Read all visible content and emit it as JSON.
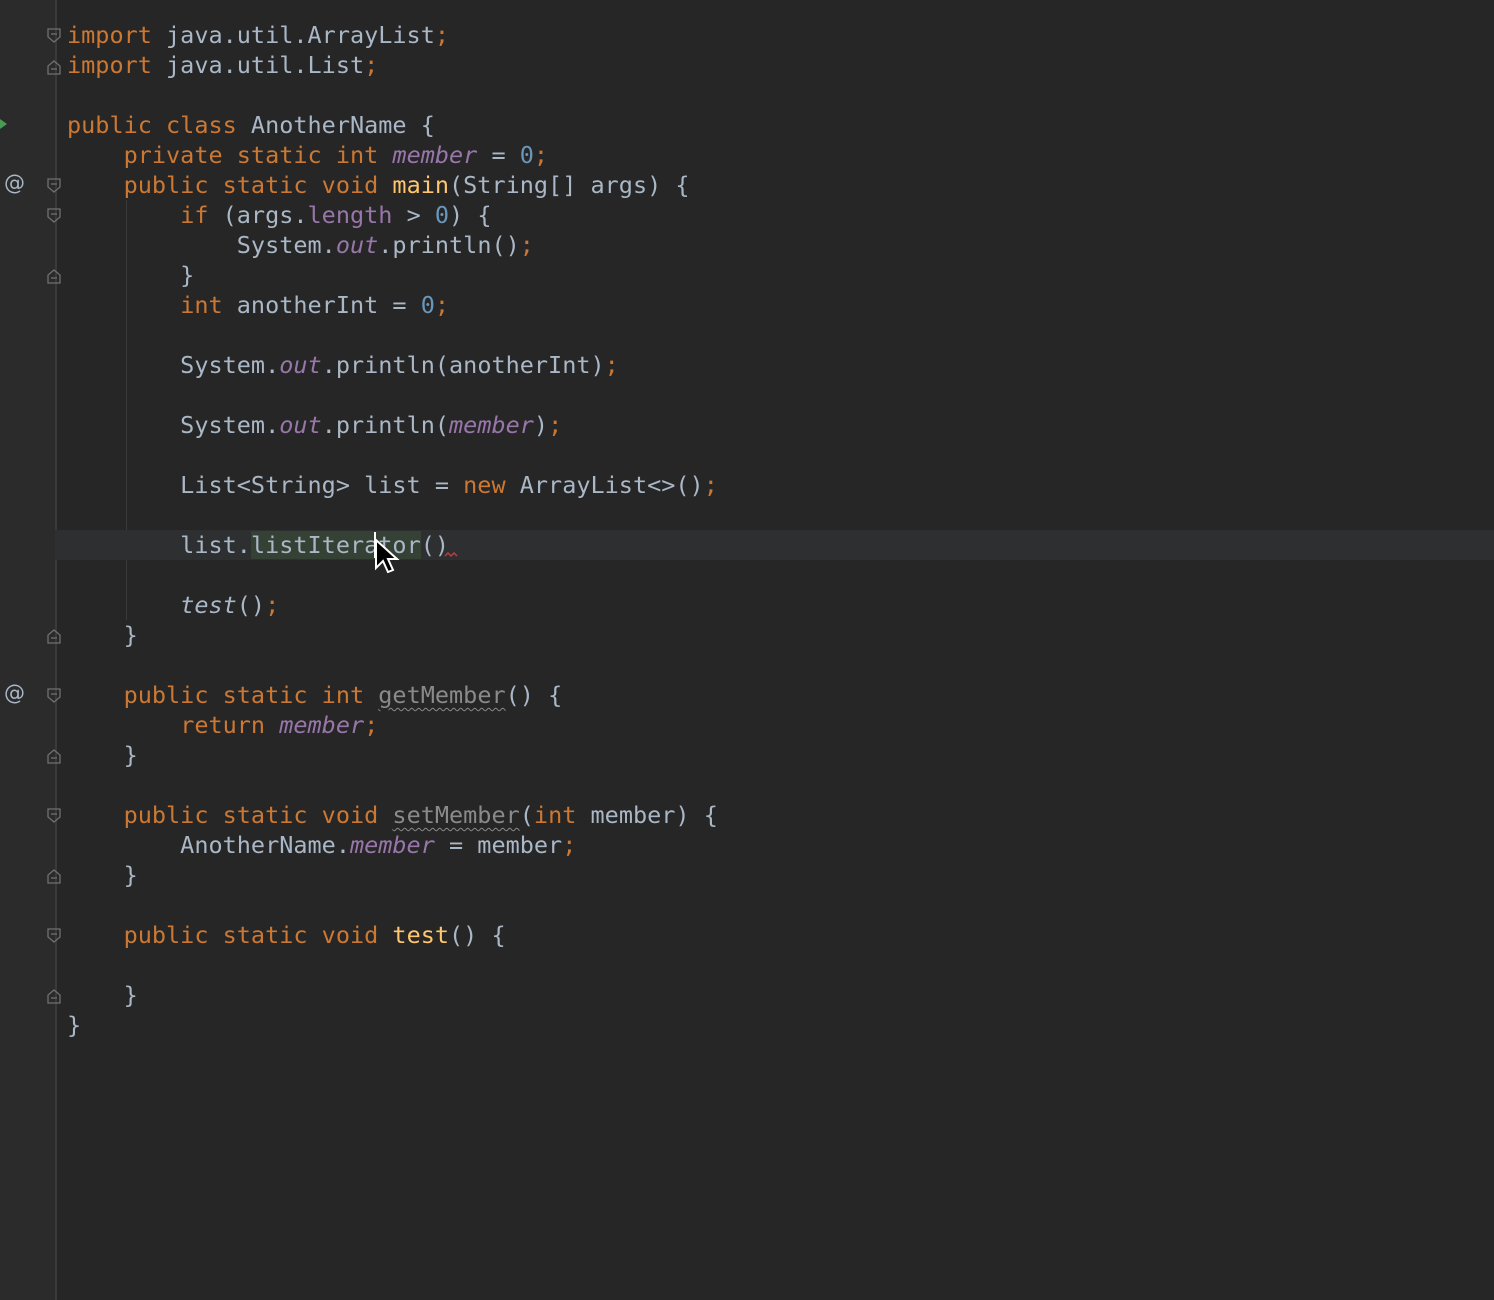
{
  "editor": {
    "lines": [
      {
        "segments": [
          {
            "t": "import",
            "c": "kw"
          },
          {
            "t": " java.util.ArrayList"
          },
          {
            "t": ";",
            "c": "kw"
          }
        ]
      },
      {
        "segments": [
          {
            "t": "import",
            "c": "kw"
          },
          {
            "t": " java.util.List"
          },
          {
            "t": ";",
            "c": "kw"
          }
        ]
      },
      {
        "segments": []
      },
      {
        "segments": [
          {
            "t": "public class",
            "c": "kw"
          },
          {
            "t": " AnotherName {"
          }
        ]
      },
      {
        "segments": [
          {
            "t": "    "
          },
          {
            "t": "private static int",
            "c": "kw"
          },
          {
            "t": " "
          },
          {
            "t": "member",
            "c": "field"
          },
          {
            "t": " = "
          },
          {
            "t": "0",
            "c": "num"
          },
          {
            "t": ";",
            "c": "kw"
          }
        ]
      },
      {
        "segments": [
          {
            "t": "    "
          },
          {
            "t": "public static void",
            "c": "kw"
          },
          {
            "t": " "
          },
          {
            "t": "main",
            "c": "fn"
          },
          {
            "t": "(String[] args) {"
          }
        ]
      },
      {
        "segments": [
          {
            "t": "        "
          },
          {
            "t": "if",
            "c": "kw"
          },
          {
            "t": " (args."
          },
          {
            "t": "length",
            "c": "field-n"
          },
          {
            "t": " > "
          },
          {
            "t": "0",
            "c": "num"
          },
          {
            "t": ") {"
          }
        ]
      },
      {
        "segments": [
          {
            "t": "            System."
          },
          {
            "t": "out",
            "c": "field"
          },
          {
            "t": ".println()"
          },
          {
            "t": ";",
            "c": "kw"
          }
        ]
      },
      {
        "segments": [
          {
            "t": "        }"
          }
        ]
      },
      {
        "segments": [
          {
            "t": "        "
          },
          {
            "t": "int",
            "c": "kw"
          },
          {
            "t": " anotherInt = "
          },
          {
            "t": "0",
            "c": "num"
          },
          {
            "t": ";",
            "c": "kw"
          }
        ]
      },
      {
        "segments": []
      },
      {
        "segments": [
          {
            "t": "        System."
          },
          {
            "t": "out",
            "c": "field"
          },
          {
            "t": ".println(anotherInt)"
          },
          {
            "t": ";",
            "c": "kw"
          }
        ]
      },
      {
        "segments": []
      },
      {
        "segments": [
          {
            "t": "        System."
          },
          {
            "t": "out",
            "c": "field"
          },
          {
            "t": ".println("
          },
          {
            "t": "member",
            "c": "field"
          },
          {
            "t": ")"
          },
          {
            "t": ";",
            "c": "kw"
          }
        ]
      },
      {
        "segments": []
      },
      {
        "segments": [
          {
            "t": "        List<String> list = "
          },
          {
            "t": "new",
            "c": "kw"
          },
          {
            "t": " ArrayList<>()"
          },
          {
            "t": ";",
            "c": "kw"
          }
        ]
      },
      {
        "segments": []
      },
      {
        "segments": [
          {
            "t": "        list."
          },
          {
            "t": "listIterator",
            "c": "hl"
          },
          {
            "t": "()"
          }
        ],
        "current": true
      },
      {
        "segments": []
      },
      {
        "segments": [
          {
            "t": "        "
          },
          {
            "t": "test",
            "c": "it"
          },
          {
            "t": "()"
          },
          {
            "t": ";",
            "c": "kw"
          }
        ]
      },
      {
        "segments": [
          {
            "t": "    }"
          }
        ]
      },
      {
        "segments": []
      },
      {
        "segments": [
          {
            "t": "    "
          },
          {
            "t": "public static int",
            "c": "kw"
          },
          {
            "t": " "
          },
          {
            "t": "getMember",
            "c": "unused"
          },
          {
            "t": "() {"
          }
        ]
      },
      {
        "segments": [
          {
            "t": "        "
          },
          {
            "t": "return",
            "c": "kw"
          },
          {
            "t": " "
          },
          {
            "t": "member",
            "c": "field"
          },
          {
            "t": ";",
            "c": "kw"
          }
        ]
      },
      {
        "segments": [
          {
            "t": "    }"
          }
        ]
      },
      {
        "segments": []
      },
      {
        "segments": [
          {
            "t": "    "
          },
          {
            "t": "public static void",
            "c": "kw"
          },
          {
            "t": " "
          },
          {
            "t": "setMember",
            "c": "unused"
          },
          {
            "t": "("
          },
          {
            "t": "int",
            "c": "kw"
          },
          {
            "t": " member) {"
          }
        ]
      },
      {
        "segments": [
          {
            "t": "        AnotherName."
          },
          {
            "t": "member",
            "c": "field"
          },
          {
            "t": " = member"
          },
          {
            "t": ";",
            "c": "kw"
          }
        ]
      },
      {
        "segments": [
          {
            "t": "    }"
          }
        ]
      },
      {
        "segments": []
      },
      {
        "segments": [
          {
            "t": "    "
          },
          {
            "t": "public static void",
            "c": "kw"
          },
          {
            "t": " "
          },
          {
            "t": "test",
            "c": "fn"
          },
          {
            "t": "() {"
          }
        ]
      },
      {
        "segments": []
      },
      {
        "segments": [
          {
            "t": "    }"
          }
        ]
      },
      {
        "segments": [
          {
            "t": "}"
          }
        ]
      }
    ]
  },
  "gutter": {
    "override_markers": [
      "@",
      "@"
    ],
    "run_marker": "run-icon"
  },
  "colors": {
    "background": "#262626",
    "keyword": "#cc7832",
    "method_decl": "#ffc66d",
    "number": "#6897bb",
    "field": "#9876aa",
    "text": "#a9b7c6"
  }
}
